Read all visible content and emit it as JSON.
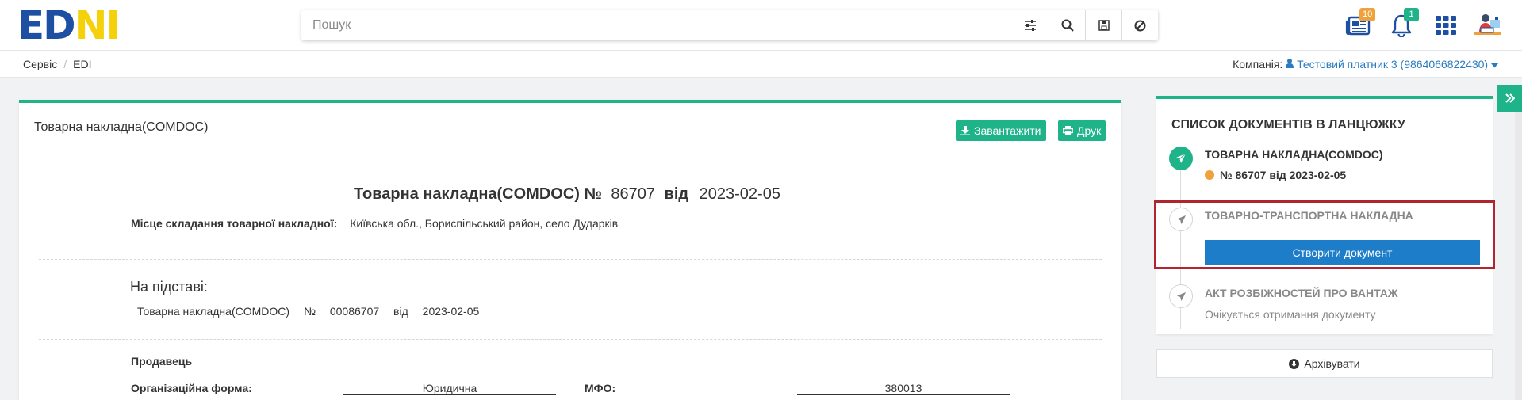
{
  "logo": {
    "text_a": "ED",
    "text_b": "N",
    "text_c": "I"
  },
  "search": {
    "placeholder": "Пошук"
  },
  "header_icons": {
    "news_badge": "10",
    "notif_badge": "1"
  },
  "breadcrumb": {
    "items": [
      "Сервіс",
      "EDI"
    ]
  },
  "company": {
    "label": "Компанія:",
    "value": "Тестовий платник 3 (9864066822430)"
  },
  "card": {
    "title": "Товарна накладна(COMDOC)",
    "download_label": "Завантажити",
    "print_label": "Друк"
  },
  "doc": {
    "heading": "Товарна накладна(COMDOC) №",
    "number": "86707",
    "from_word": "від",
    "date": "2023-02-05",
    "place_label": "Місце складання товарної накладної:",
    "place_value": "Київська обл., Бориспільський район, село Дударків",
    "basis_heading": "На підставі:",
    "basis_doc": "Товарна накладна(COMDOC)",
    "basis_no_sign": "№",
    "basis_number": "00086707",
    "basis_from": "від",
    "basis_date": "2023-02-05",
    "seller_heading": "Продавець",
    "org_form_label": "Організаційна форма:",
    "org_form_value": "Юридична",
    "mfo_label": "МФО:",
    "mfo_value": "380013"
  },
  "chain": {
    "title": "СПИСОК ДОКУМЕНТІВ В ЛАНЦЮЖКУ",
    "steps": [
      {
        "title": "ТОВАРНА НАКЛАДНА(COMDOC)",
        "sub": "№ 86707 від 2023-02-05"
      },
      {
        "title": "ТОВАРНО-ТРАНСПОРТНА НАКЛАДНА",
        "button": "Створити документ"
      },
      {
        "title": "АКТ РОЗБІЖНОСТЕЙ ПРО ВАНТАЖ",
        "sub": "Очікується отримання документу"
      }
    ]
  },
  "archive_label": "Архівувати",
  "colors": {
    "accent": "#1fb38a",
    "primary": "#1e7dc9",
    "highlight": "#b0252f",
    "status_dot": "#f0a13c",
    "link": "#2a7bbf"
  },
  "icons": [
    "sliders-icon",
    "search-icon",
    "save-icon",
    "block-icon",
    "news-icon",
    "bell-icon",
    "apps-grid-icon",
    "user-avatar-icon",
    "download-icon",
    "print-icon",
    "paper-plane-icon",
    "archive-icon",
    "chevrons-right-icon",
    "user-icon",
    "caret-down-icon"
  ]
}
